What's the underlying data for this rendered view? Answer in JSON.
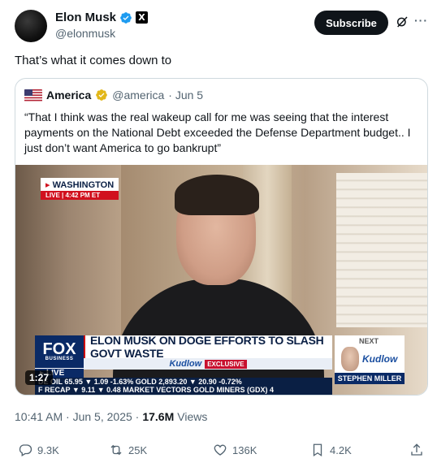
{
  "author": {
    "name": "Elon Musk",
    "handle": "@elonmusk",
    "affiliate_badge": "X"
  },
  "header": {
    "subscribe_label": "Subscribe",
    "more_label": "···"
  },
  "tweet": {
    "text": "That’s what it comes down to"
  },
  "quote": {
    "name": "America",
    "handle": "@america",
    "date": "· Jun 5",
    "text": "“That I think was the real wakeup call for me was seeing that the interest payments on the National Debt exceeded the Defense Department budget.. I just don’t want America to go bankrupt”"
  },
  "video": {
    "location": "WASHINGTON",
    "live_time": "LIVE | 4:42 PM ET",
    "network": "FOX",
    "network_sub": "BUSINESS",
    "live": "LIVE",
    "headline": "ELON MUSK ON DOGE EFFORTS TO SLASH GOVT WASTE",
    "show": "Kudlow",
    "exclusive": "EXCLUSIVE",
    "ticker_line1": "DE OIL   65.95 ▼ 1.09  -1.63% GOLD  2,893.20 ▼ 20.90 -0.72%",
    "ticker_line2": "F RECAP  ▼ 9.11 ▼ 0.48   MARKET VECTORS GOLD MINERS (GDX)  4",
    "next_label": "NEXT",
    "next_show": "Kudlow",
    "next_guest": "STEPHEN MILLER",
    "duration": "1:27"
  },
  "meta": {
    "timestamp": "10:41 AM · Jun 5, 2025 ·",
    "views_count": "17.6M",
    "views_label": "Views"
  },
  "actions": {
    "replies": "9.3K",
    "reposts": "25K",
    "likes": "136K",
    "bookmarks": "4.2K"
  },
  "colors": {
    "verified_blue": "#1d9bf0",
    "gold_badge": "#e2b719",
    "text_primary": "#0f1419",
    "text_secondary": "#536471"
  }
}
